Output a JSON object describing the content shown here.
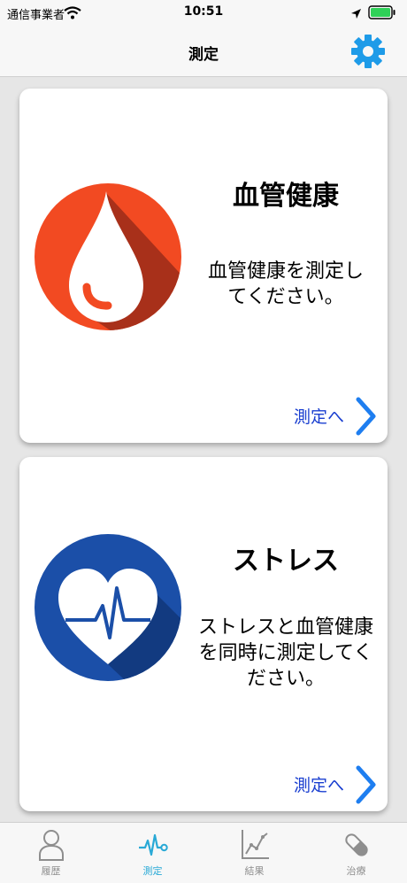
{
  "status_bar": {
    "carrier": "通信事業者",
    "time": "10:51"
  },
  "nav": {
    "title": "測定"
  },
  "cards": [
    {
      "title": "血管健康",
      "desc_lines": [
        "血管健康を測定し",
        "てください。"
      ],
      "link_label": "測定へ",
      "emblem_icon": "blood-drop-icon",
      "emblem_color": "#f24a22"
    },
    {
      "title": "ストレス",
      "desc_lines": [
        "ストレスと血管健康",
        "を同時に測定してく",
        "ださい。"
      ],
      "link_label": "測定へ",
      "emblem_icon": "heart-pulse-icon",
      "emblem_color": "#1b4fa8"
    }
  ],
  "tabs": [
    {
      "label": "履歴",
      "icon": "person-icon",
      "active": false
    },
    {
      "label": "測定",
      "icon": "pulse-icon",
      "active": true
    },
    {
      "label": "結果",
      "icon": "line-chart-icon",
      "active": false
    },
    {
      "label": "治療",
      "icon": "capsule-icon",
      "active": false
    }
  ],
  "colors": {
    "accent": "#29a9d6",
    "link": "#1a3fd0",
    "chevron": "#1e7ef0"
  }
}
